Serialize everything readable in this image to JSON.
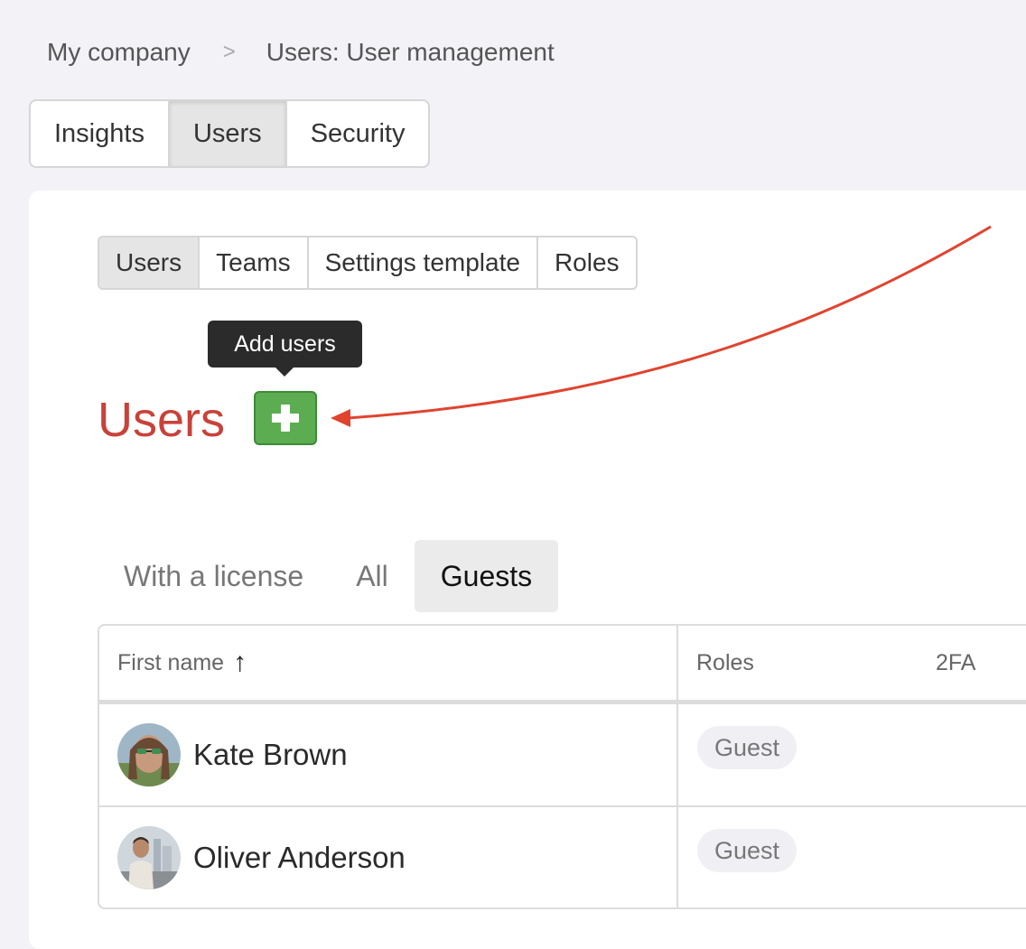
{
  "breadcrumb": {
    "root": "My company",
    "separator": ">",
    "current": "Users: User management"
  },
  "top_tabs": [
    {
      "label": "Insights",
      "active": false
    },
    {
      "label": "Users",
      "active": true
    },
    {
      "label": "Security",
      "active": false
    }
  ],
  "sub_tabs": [
    {
      "label": "Users",
      "active": true
    },
    {
      "label": "Teams",
      "active": false
    },
    {
      "label": "Settings template",
      "active": false
    },
    {
      "label": "Roles",
      "active": false
    }
  ],
  "tooltip": "Add users",
  "section": {
    "title": "Users",
    "add_icon": "plus-icon"
  },
  "filter_tabs": [
    {
      "label": "With a license",
      "active": false
    },
    {
      "label": "All",
      "active": false
    },
    {
      "label": "Guests",
      "active": true
    }
  ],
  "table": {
    "columns": {
      "first_name": "First name",
      "sort_icon": "↑",
      "roles": "Roles",
      "twofa": "2FA"
    },
    "rows": [
      {
        "name": "Kate Brown",
        "role": "Guest"
      },
      {
        "name": "Oliver Anderson",
        "role": "Guest"
      }
    ]
  },
  "colors": {
    "accent_red": "#c8423a",
    "add_green": "#5cad52",
    "annotation_arrow": "#e0442f"
  }
}
